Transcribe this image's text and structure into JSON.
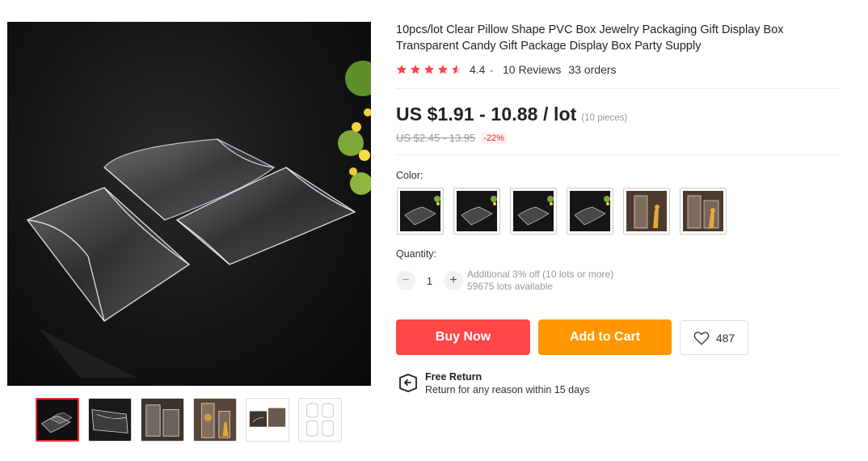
{
  "gallery": {
    "main_image": "clear-pillow-boxes-photo",
    "thumbnails": [
      "thumb-pillow-boxes",
      "thumb-clear-tubes",
      "thumb-clear-cubes",
      "thumb-giraffe-boxes",
      "thumb-boxes-group",
      "thumb-outline-drawing"
    ],
    "active_index": 0
  },
  "product": {
    "title": "10pcs/lot Clear Pillow Shape PVC Box Jewelry Packaging Gift Display Box Transparent Candy Gift Package Display Box Party Supply"
  },
  "rating": {
    "stars": 4.4,
    "value": "4.4",
    "reviews": "10 Reviews",
    "orders": "33 orders",
    "star_color": "#ff4747"
  },
  "price": {
    "current": "US $1.91 - 10.88 / lot",
    "pieces": "(10 pieces)",
    "original": "US $2.45 - 13.95",
    "discount": "-22%"
  },
  "color": {
    "label": "Color:",
    "options": [
      "pillow-box-photo",
      "pillow-box-photo",
      "pillow-box-photo",
      "pillow-box-photo",
      "giraffe-box-photo",
      "giraffe-box-photo"
    ]
  },
  "quantity": {
    "label": "Quantity:",
    "minus": "−",
    "value": "1",
    "plus": "+",
    "discount_note": "Additional 3% off (10 lots or more)",
    "available": "59675 lots available"
  },
  "actions": {
    "buy_now": "Buy Now",
    "add_to_cart": "Add to Cart",
    "wishlist_count": "487",
    "buy_color": "#ff4747",
    "cart_color": "#ff9800"
  },
  "free_return": {
    "title": "Free Return",
    "subtitle": "Return for any reason within 15 days",
    "icon": "return-box-icon"
  }
}
